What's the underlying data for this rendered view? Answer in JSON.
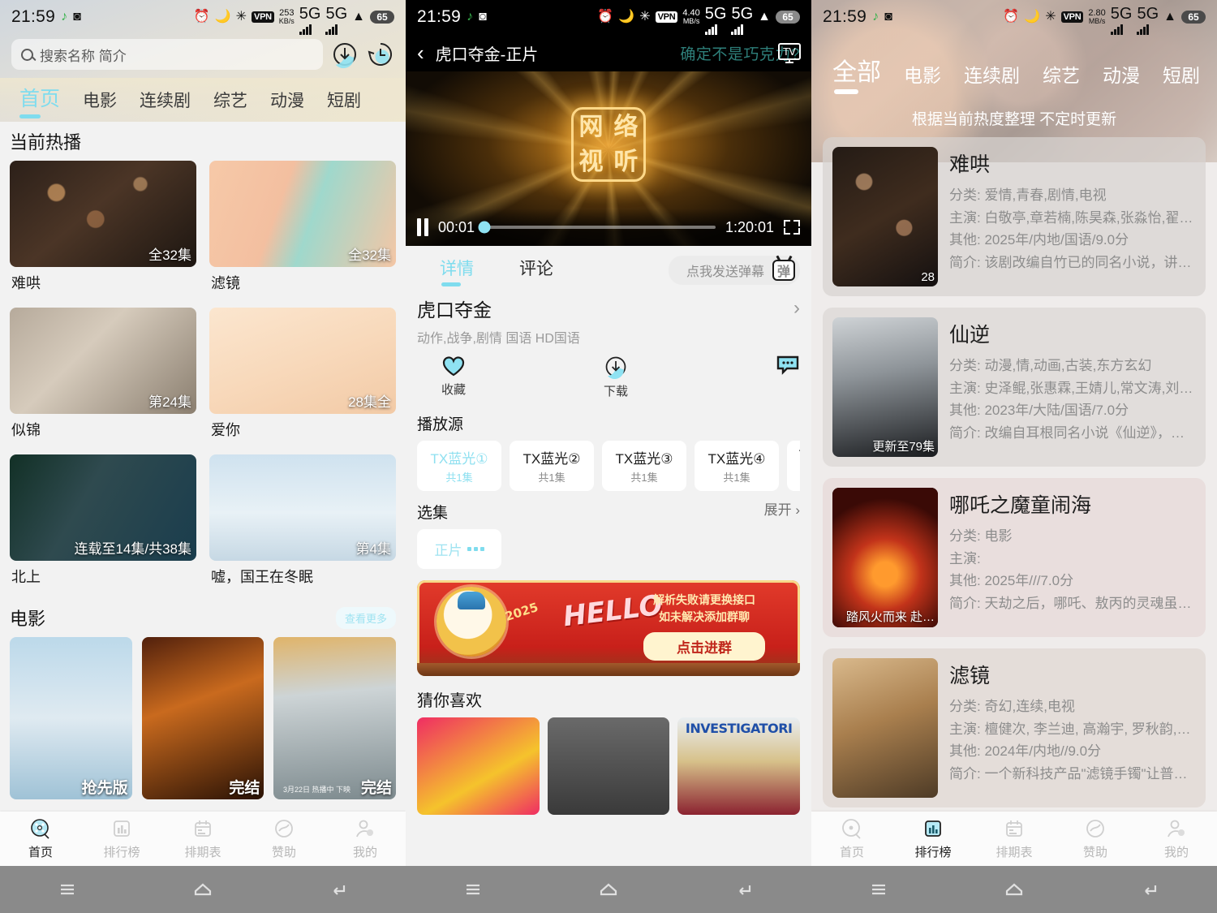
{
  "statusbars": {
    "time": "21:59",
    "panel1": {
      "rate": "253",
      "rate_unit": "KB/s",
      "battery": "65",
      "vpn": "VPN",
      "net1": "5G",
      "net2": "5G"
    },
    "panel2": {
      "rate": "4.40",
      "rate_unit": "MB/s",
      "battery": "65",
      "vpn": "VPN",
      "net1": "5G",
      "net2": "5G"
    },
    "panel3": {
      "rate": "2.80",
      "rate_unit": "MB/s",
      "battery": "65",
      "vpn": "VPN",
      "net1": "5G",
      "net2": "5G"
    }
  },
  "home": {
    "search_placeholder": "搜索名称 简介",
    "download_icon": "download-circle-icon",
    "history_icon": "history-circle-icon",
    "tabs": [
      {
        "label": "首页",
        "active": true
      },
      {
        "label": "电影",
        "active": false
      },
      {
        "label": "连续剧",
        "active": false
      },
      {
        "label": "综艺",
        "active": false
      },
      {
        "label": "动漫",
        "active": false
      },
      {
        "label": "短剧",
        "active": false
      }
    ],
    "hot_section_title": "当前热播",
    "hot_items": [
      {
        "title": "难哄",
        "badge": "全32集",
        "art": "a-nanhong"
      },
      {
        "title": "滤镜",
        "badge": "全32集",
        "art": "a-lvjing"
      },
      {
        "title": "似锦",
        "badge": "第24集",
        "art": "a-sijin"
      },
      {
        "title": "爱你",
        "badge": "28集全",
        "art": "a-aini"
      },
      {
        "title": "北上",
        "badge": "连载至14集/共38集",
        "art": "a-beishang"
      },
      {
        "title": "嘘，国王在冬眠",
        "badge": "第4集",
        "art": "a-wang"
      }
    ],
    "movie_section_title": "电影",
    "movie_more": "查看更多",
    "movies": [
      {
        "badge": "抢先版",
        "sub": "",
        "art": "a-m1"
      },
      {
        "badge": "完结",
        "sub": "",
        "art": "a-m2"
      },
      {
        "badge": "完结",
        "sub": "3月22日 热播中 下映",
        "art": "a-m3"
      }
    ],
    "bottom_nav": [
      {
        "label": "首页",
        "icon": "film-reel-icon",
        "active": true
      },
      {
        "label": "排行榜",
        "icon": "chart-bars-icon",
        "active": false
      },
      {
        "label": "排期表",
        "icon": "calendar-icon",
        "active": false
      },
      {
        "label": "赞助",
        "icon": "sponsor-icon",
        "active": false
      },
      {
        "label": "我的",
        "icon": "person-icon",
        "active": false
      }
    ]
  },
  "player": {
    "back_icon": "back-chevron-icon",
    "title": "虎口夺金-正片",
    "choco_text": "确定不是巧克力?",
    "tv_icon": "tv-cast-icon",
    "video_logo": "网络视听",
    "current_time": "00:01",
    "total_time": "1:20:01",
    "progress_percent": 1,
    "pause_icon": "pause-icon",
    "fullscreen_icon": "fullscreen-icon",
    "tabs": [
      {
        "label": "详情",
        "active": true
      },
      {
        "label": "评论",
        "active": false
      }
    ],
    "danmu_placeholder": "点我发送弹幕",
    "danmu_icon": "danmu-tv-icon",
    "danmu_icon_char": "弹",
    "movie_name": "虎口夺金",
    "movie_meta": "动作,战争,剧情 国语 HD国语",
    "actions": [
      {
        "label": "收藏",
        "icon": "heart-icon"
      },
      {
        "label": "下载",
        "icon": "download-circle-icon"
      },
      {
        "label": "",
        "icon": "comment-bubble-icon"
      }
    ],
    "source_title": "播放源",
    "sources": [
      {
        "name": "TX蓝光①",
        "count": "共1集",
        "active": true
      },
      {
        "name": "TX蓝光②",
        "count": "共1集",
        "active": false
      },
      {
        "name": "TX蓝光③",
        "count": "共1集",
        "active": false
      },
      {
        "name": "TX蓝光④",
        "count": "共1集",
        "active": false
      },
      {
        "name": "T",
        "count": "",
        "active": false
      }
    ],
    "episodes_title": "选集",
    "expand_label": "展开",
    "episodes": [
      {
        "label": "正片",
        "active": true
      }
    ],
    "banner": {
      "hello": "HELLO",
      "year": "2025",
      "line1": "解析失败请更换接口",
      "line2": "如未解决添加群聊",
      "button": "点击进群"
    },
    "rec_title": "猜你喜欢",
    "recs": [
      {
        "art": "r-a"
      },
      {
        "art": "r-b"
      },
      {
        "art": "r-c"
      }
    ],
    "bottom_nav_hidden": true
  },
  "ranking": {
    "tabs": [
      {
        "label": "全部",
        "active": true
      },
      {
        "label": "电影",
        "active": false
      },
      {
        "label": "连续剧",
        "active": false
      },
      {
        "label": "综艺",
        "active": false
      },
      {
        "label": "动漫",
        "active": false
      },
      {
        "label": "短剧",
        "active": false
      }
    ],
    "subtitle": "根据当前热度整理 不定时更新",
    "labels": {
      "category": "分类:",
      "cast": "主演:",
      "other": "其他:",
      "summary": "简介:"
    },
    "items": [
      {
        "title": "难哄",
        "episode_badge": "28",
        "category": "爱情,青春,剧情,电视",
        "cast": "白敬亭,章若楠,陈昊森,张淼怡,翟…",
        "other": "2025年/内地/国语/9.0分",
        "summary": "该剧改编自竹已的同名小说，讲…",
        "art": "t-nanhong"
      },
      {
        "title": "仙逆",
        "episode_badge": "更新至79集",
        "category": "动漫,情,动画,古装,东方玄幻",
        "cast": "史泽鲲,张惠霖,王婧儿,常文涛,刘…",
        "other": "2023年/大陆/国语/7.0分",
        "summary": "改编自耳根同名小说《仙逆》，讲…",
        "art": "t-xianni"
      },
      {
        "title": "哪吒之魔童闹海",
        "episode_badge": "踏风火而来 赴…",
        "category": "电影",
        "cast": "",
        "other": "2025年///7.0分",
        "summary": "天劫之后，哪吒、敖丙的灵魂虽…",
        "art": "t-nezha"
      },
      {
        "title": "滤镜",
        "episode_badge": "",
        "category": "奇幻,连续,电视",
        "cast": "檀健次, 李兰迪, 高瀚宇, 罗秋韵,…",
        "other": "2024年/内地//9.0分",
        "summary": "一个新科技产品\"滤镜手镯\"让普…",
        "art": "t-lvjing"
      }
    ],
    "bottom_nav": [
      {
        "label": "首页",
        "icon": "film-reel-icon",
        "active": false
      },
      {
        "label": "排行榜",
        "icon": "chart-bars-icon",
        "active": true
      },
      {
        "label": "排期表",
        "icon": "calendar-icon",
        "active": false
      },
      {
        "label": "赞助",
        "icon": "sponsor-icon",
        "active": false
      },
      {
        "label": "我的",
        "icon": "person-icon",
        "active": false
      }
    ]
  },
  "system_nav": {
    "menu": "menu-icon",
    "home": "home-icon",
    "back": "back-icon"
  }
}
